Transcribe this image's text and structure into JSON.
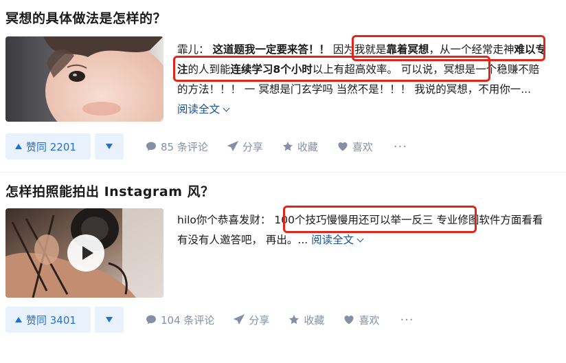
{
  "answers": [
    {
      "question": "冥想的具体做法是怎样的？",
      "author": "霏儿：",
      "excerpt": {
        "a": "这道题我一定要来答！！",
        "b": "因为我就是",
        "c": "靠着冥想",
        "d": "，从一个经常",
        "e": "走神",
        "f": "难以专注",
        "g": "的人到能",
        "h": "连续学习8个小时",
        "i": "以上有超高效率。",
        "j": "可以说，冥想是一个稳赚不赔的方法！！！ 一 冥想是门玄学吗 当然不是！！！ 我说的冥想，不用你一..."
      },
      "read_more": "阅读全文",
      "upvote_label": "赞同 2201",
      "comments": "85 条评论",
      "share": "分享",
      "favorite": "收藏",
      "like": "喜欢",
      "more": "···"
    },
    {
      "question": "怎样拍照能拍出 Instagram 风？",
      "author": "hilo你个恭喜发财：",
      "excerpt": {
        "a": "100个技巧慢慢用还可以举一反三",
        "b": "专业修图软件方面看看有没有人邀答吧， 再出。..."
      },
      "read_more": "阅读全文",
      "upvote_label": "赞同 3401",
      "comments": "104 条评论",
      "share": "分享",
      "favorite": "收藏",
      "like": "喜欢",
      "more": "···"
    }
  ],
  "colors": {
    "accent": "#1e6fd9",
    "accent_bg": "#e9f2fc",
    "link": "#175199",
    "muted": "#8590a6",
    "highlight_box": "#e1251b"
  },
  "icons": [
    "comment-icon",
    "share-icon",
    "star-icon",
    "heart-icon",
    "chevron-down-icon",
    "play-icon"
  ]
}
